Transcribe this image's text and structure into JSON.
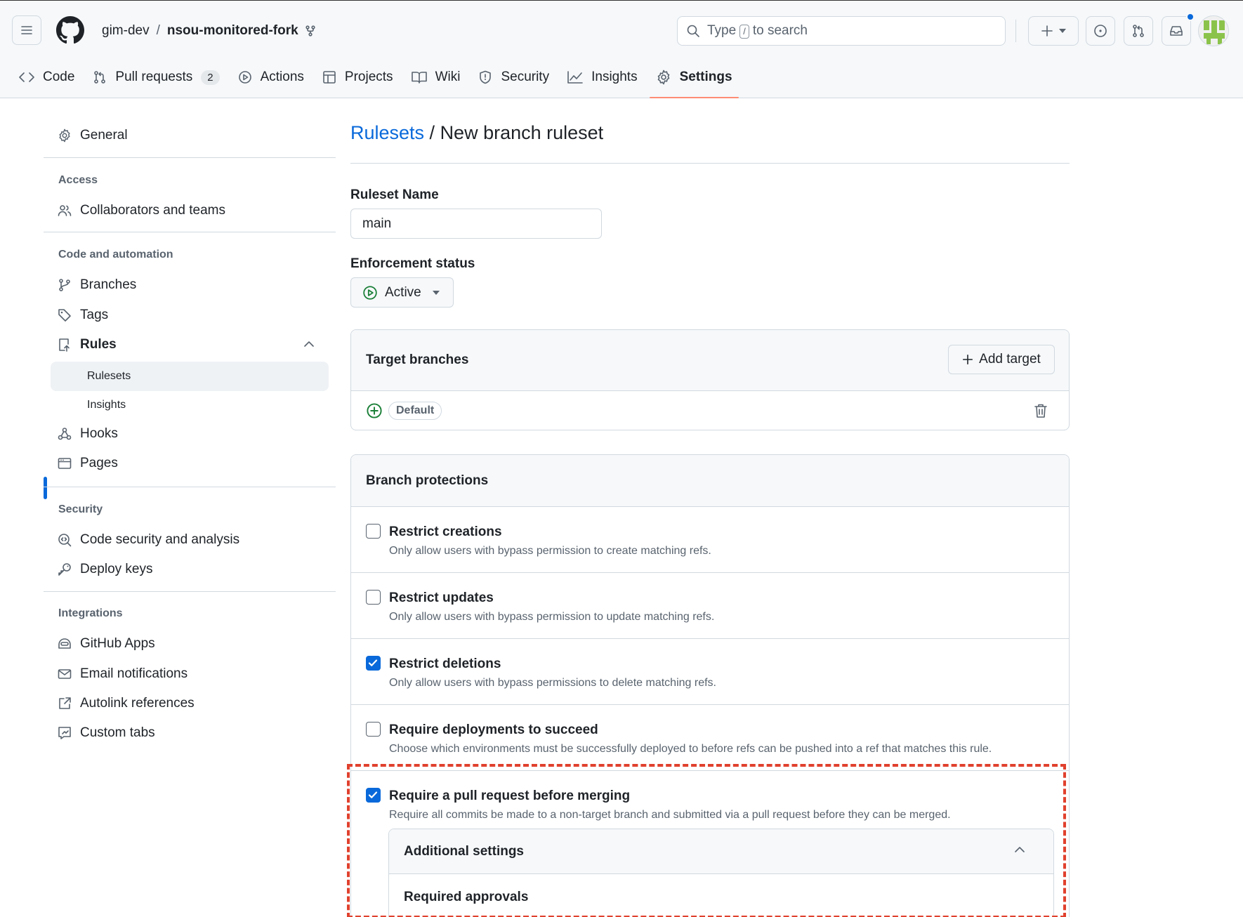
{
  "header": {
    "owner": "gim-dev",
    "separator": "/",
    "repo": "nsou-monitored-fork",
    "search": {
      "prefix": "Type",
      "key": "/",
      "suffix": "to search"
    }
  },
  "repo_nav": {
    "tabs": [
      {
        "label": "Code",
        "icon": "code-icon"
      },
      {
        "label": "Pull requests",
        "icon": "pull-request-icon",
        "count": "2"
      },
      {
        "label": "Actions",
        "icon": "play-icon"
      },
      {
        "label": "Projects",
        "icon": "table-icon"
      },
      {
        "label": "Wiki",
        "icon": "book-icon"
      },
      {
        "label": "Security",
        "icon": "shield-icon"
      },
      {
        "label": "Insights",
        "icon": "graph-icon"
      },
      {
        "label": "Settings",
        "icon": "gear-icon",
        "selected": true
      }
    ]
  },
  "sidebar": {
    "general": "General",
    "access_heading": "Access",
    "collaborators": "Collaborators and teams",
    "code_heading": "Code and automation",
    "branches": "Branches",
    "tags": "Tags",
    "rules": "Rules",
    "rulesets": "Rulesets",
    "insights": "Insights",
    "hooks": "Hooks",
    "pages": "Pages",
    "security_heading": "Security",
    "code_security": "Code security and analysis",
    "deploy_keys": "Deploy keys",
    "integrations_heading": "Integrations",
    "github_apps": "GitHub Apps",
    "email_notifications": "Email notifications",
    "autolink": "Autolink references",
    "custom_tabs": "Custom tabs"
  },
  "main": {
    "breadcrumb_link": "Rulesets",
    "breadcrumb_sep": " / ",
    "title": "New branch ruleset",
    "ruleset_name_label": "Ruleset Name",
    "ruleset_name_value": "main",
    "enforcement_label": "Enforcement status",
    "enforcement_value": "Active",
    "target_heading": "Target branches",
    "add_target": "Add target",
    "default_label": "Default",
    "protections_heading": "Branch protections",
    "rules": [
      {
        "title": "Restrict creations",
        "desc": "Only allow users with bypass permission to create matching refs.",
        "checked": false
      },
      {
        "title": "Restrict updates",
        "desc": "Only allow users with bypass permission to update matching refs.",
        "checked": false
      },
      {
        "title": "Restrict deletions",
        "desc": "Only allow users with bypass permissions to delete matching refs.",
        "checked": true
      },
      {
        "title": "Require deployments to succeed",
        "desc": "Choose which environments must be successfully deployed to before refs can be pushed into a ref that matches this rule.",
        "checked": false
      },
      {
        "title": "Require a pull request before merging",
        "desc": "Require all commits be made to a non-target branch and submitted via a pull request before they can be merged.",
        "checked": true
      }
    ],
    "additional_settings": "Additional settings",
    "required_approvals": "Required approvals"
  },
  "colors": {
    "accent": "#0969da",
    "highlight": "#e0412e",
    "tab_underline": "#fd8c73",
    "success": "#1a7f37"
  }
}
